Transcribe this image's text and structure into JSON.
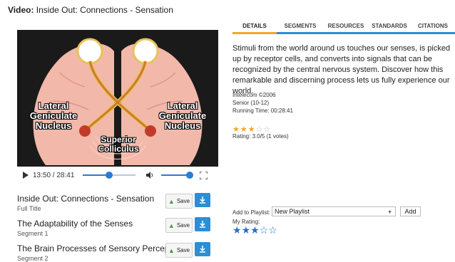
{
  "video_title": {
    "prefix": "Video:",
    "text": "Inside Out: Connections - Sensation"
  },
  "player": {
    "labels": {
      "left": "Lateral\nGeniculate\nNucleus",
      "right": "Lateral\nGeniculate\nNucleus",
      "center": "Superior\nColliculus"
    },
    "time": "13:50 / 28:41",
    "progress": 0.49,
    "volume": 1.0
  },
  "items": [
    {
      "title": "Inside Out: Connections - Sensation",
      "subtitle": "Full Title",
      "save": "Save"
    },
    {
      "title": "The Adaptability of the Senses",
      "subtitle": "Segment 1",
      "save": "Save"
    },
    {
      "title": "The Brain Processes of Sensory Perception",
      "subtitle": "Segment 2",
      "save": "Save"
    }
  ],
  "tabs": [
    "DETAILS",
    "SEGMENTS",
    "RESOURCES",
    "STANDARDS",
    "CITATIONS"
  ],
  "active_tab": "DETAILS",
  "description": "Stimuli from the world around us touches our senses, is picked up by receptor cells, and converts into signals that can be recognized by the central nervous system. Discover how this remarkable and discerning process lets us fully experience our world.",
  "meta": {
    "publisher": "Intelecom ©2006",
    "grade": "Senior (10-12)",
    "running_time": "Running Time: 00:28:41"
  },
  "rating": {
    "value": 3,
    "max": 5,
    "text": "Rating: 3.0/5 (1 votes)"
  },
  "playlist": {
    "label": "Add to Playlist:",
    "selected": "New Playlist",
    "add": "Add"
  },
  "my_rating": {
    "label": "My Rating:",
    "value": 3,
    "max": 5
  },
  "colors": {
    "accent": "#2a8fd4",
    "active_tab": "#f5a623",
    "star_gold": "#f5a623",
    "star_blue": "#2a6fc4"
  }
}
